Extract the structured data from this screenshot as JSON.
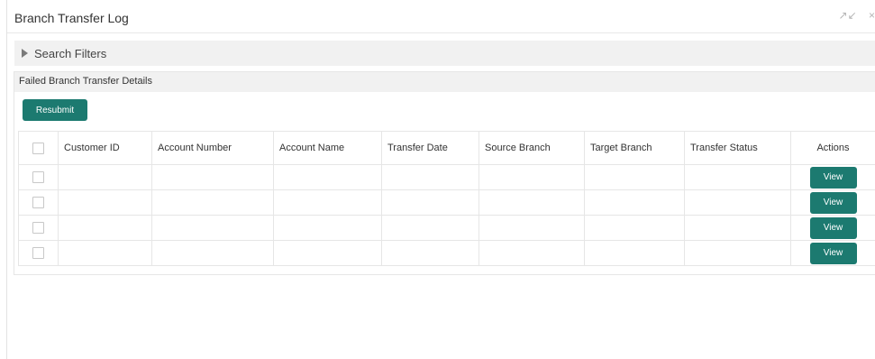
{
  "window": {
    "title": "Branch Transfer Log",
    "minimize_glyph": "↗↙",
    "close_glyph": "×"
  },
  "filters": {
    "label": "Search Filters"
  },
  "panel": {
    "title": "Failed Branch Transfer Details",
    "resubmit_label": "Resubmit"
  },
  "table": {
    "columns": [
      "Customer ID",
      "Account Number",
      "Account Name",
      "Transfer Date",
      "Source Branch",
      "Target Branch",
      "Transfer Status",
      "Actions"
    ],
    "rows": [
      {
        "view_label": "View"
      },
      {
        "view_label": "View"
      },
      {
        "view_label": "View"
      },
      {
        "view_label": "View"
      }
    ]
  },
  "colors": {
    "accent": "#1c7a70",
    "header_bg": "#f1f1f1"
  }
}
